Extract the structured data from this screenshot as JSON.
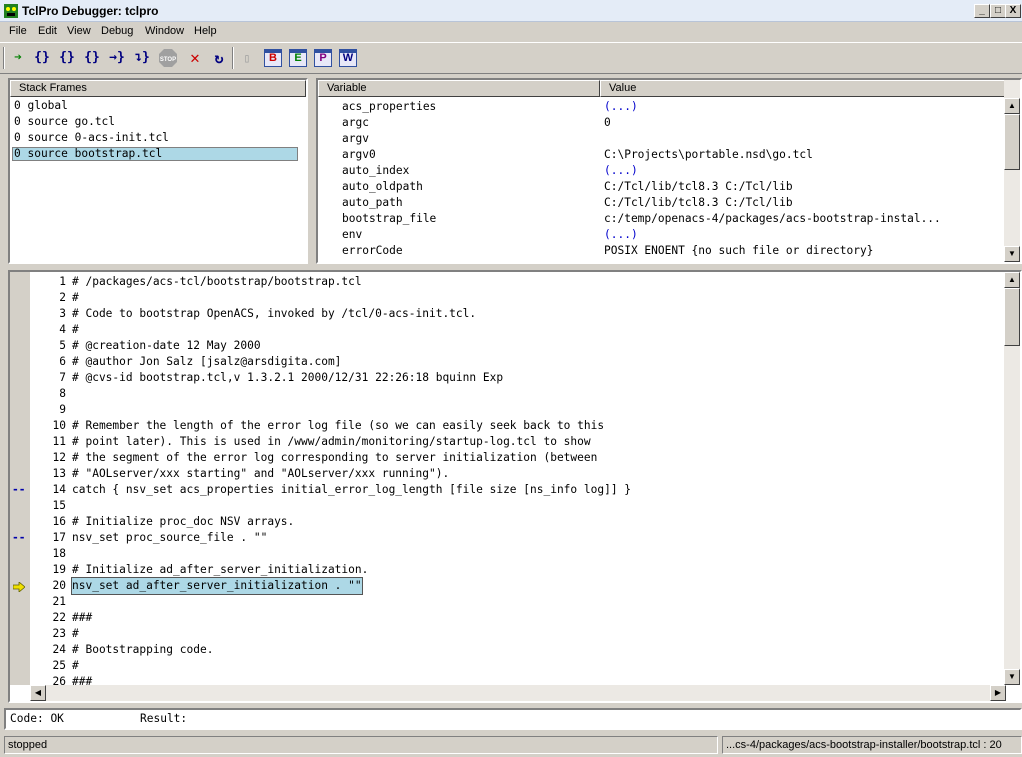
{
  "window": {
    "title": "TclPro Debugger: tclpro",
    "minimize": "_",
    "maximize": "□",
    "close": "X"
  },
  "menu": [
    "File",
    "Edit",
    "View",
    "Debug",
    "Window",
    "Help"
  ],
  "toolbar": {
    "stop_label": "STOP",
    "letters": [
      "B",
      "E",
      "P",
      "W"
    ]
  },
  "stack": {
    "header": "Stack Frames",
    "rows": [
      "0 global",
      "0 source go.tcl",
      "0 source 0-acs-init.tcl",
      "0 source bootstrap.tcl"
    ]
  },
  "variables": {
    "name_header": "Variable",
    "value_header": "Value",
    "rows": [
      {
        "name": "acs_properties",
        "value": "(...)",
        "array": true
      },
      {
        "name": "argc",
        "value": "0",
        "array": false
      },
      {
        "name": "argv",
        "value": "",
        "array": false
      },
      {
        "name": "argv0",
        "value": "C:\\Projects\\portable.nsd\\go.tcl",
        "array": false
      },
      {
        "name": "auto_index",
        "value": "(...)",
        "array": true
      },
      {
        "name": "auto_oldpath",
        "value": "C:/Tcl/lib/tcl8.3 C:/Tcl/lib",
        "array": false
      },
      {
        "name": "auto_path",
        "value": "C:/Tcl/lib/tcl8.3 C:/Tcl/lib",
        "array": false
      },
      {
        "name": "bootstrap_file",
        "value": "c:/temp/openacs-4/packages/acs-bootstrap-instal...",
        "array": false
      },
      {
        "name": "env",
        "value": "(...)",
        "array": true
      },
      {
        "name": "errorCode",
        "value": "POSIX ENOENT {no such file or directory}",
        "array": false
      }
    ]
  },
  "source": {
    "current_line": 20,
    "lines": [
      {
        "n": "1",
        "text": "# /packages/acs-tcl/bootstrap/bootstrap.tcl",
        "marker": ""
      },
      {
        "n": "2",
        "text": "#",
        "marker": ""
      },
      {
        "n": "3",
        "text": "# Code to bootstrap OpenACS, invoked by /tcl/0-acs-init.tcl.",
        "marker": ""
      },
      {
        "n": "4",
        "text": "#",
        "marker": ""
      },
      {
        "n": "5",
        "text": "# @creation-date 12 May 2000",
        "marker": ""
      },
      {
        "n": "6",
        "text": "# @author Jon Salz [jsalz@arsdigita.com]",
        "marker": ""
      },
      {
        "n": "7",
        "text": "# @cvs-id bootstrap.tcl,v 1.3.2.1 2000/12/31 22:26:18 bquinn Exp",
        "marker": ""
      },
      {
        "n": "8",
        "text": "",
        "marker": ""
      },
      {
        "n": "9",
        "text": "",
        "marker": ""
      },
      {
        "n": "10",
        "text": "# Remember the length of the error log file (so we can easily seek back to this",
        "marker": ""
      },
      {
        "n": "11",
        "text": "# point later). This is used in /www/admin/monitoring/startup-log.tcl to show",
        "marker": ""
      },
      {
        "n": "12",
        "text": "# the segment of the error log corresponding to server initialization (between",
        "marker": ""
      },
      {
        "n": "13",
        "text": "# \"AOLserver/xxx starting\" and \"AOLserver/xxx running\").",
        "marker": ""
      },
      {
        "n": "14",
        "text": "catch { nsv_set acs_properties initial_error_log_length [file size [ns_info log]] }",
        "marker": "--"
      },
      {
        "n": "15",
        "text": "",
        "marker": ""
      },
      {
        "n": "16",
        "text": "# Initialize proc_doc NSV arrays.",
        "marker": ""
      },
      {
        "n": "17",
        "text": "nsv_set proc_source_file . \"\"",
        "marker": "--"
      },
      {
        "n": "18",
        "text": "",
        "marker": ""
      },
      {
        "n": "19",
        "text": "# Initialize ad_after_server_initialization.",
        "marker": ""
      },
      {
        "n": "20",
        "text": "nsv_set ad_after_server_initialization . \"\"",
        "marker": "arrow"
      },
      {
        "n": "21",
        "text": "",
        "marker": ""
      },
      {
        "n": "22",
        "text": "###",
        "marker": ""
      },
      {
        "n": "23",
        "text": "#",
        "marker": ""
      },
      {
        "n": "24",
        "text": "# Bootstrapping code.",
        "marker": ""
      },
      {
        "n": "25",
        "text": "#",
        "marker": ""
      },
      {
        "n": "26",
        "text": "###",
        "marker": ""
      }
    ]
  },
  "result": {
    "code_label": "Code:",
    "code_value": "OK",
    "result_label": "Result:",
    "result_value": ""
  },
  "status": {
    "state": "stopped",
    "file": "...cs-4/packages/acs-bootstrap-installer/bootstrap.tcl : 20"
  },
  "colors": {
    "highlight": "#add8e6",
    "array_value": "#0000cc",
    "breakpoint": "#0000aa",
    "pc_arrow": "#f0e000"
  }
}
